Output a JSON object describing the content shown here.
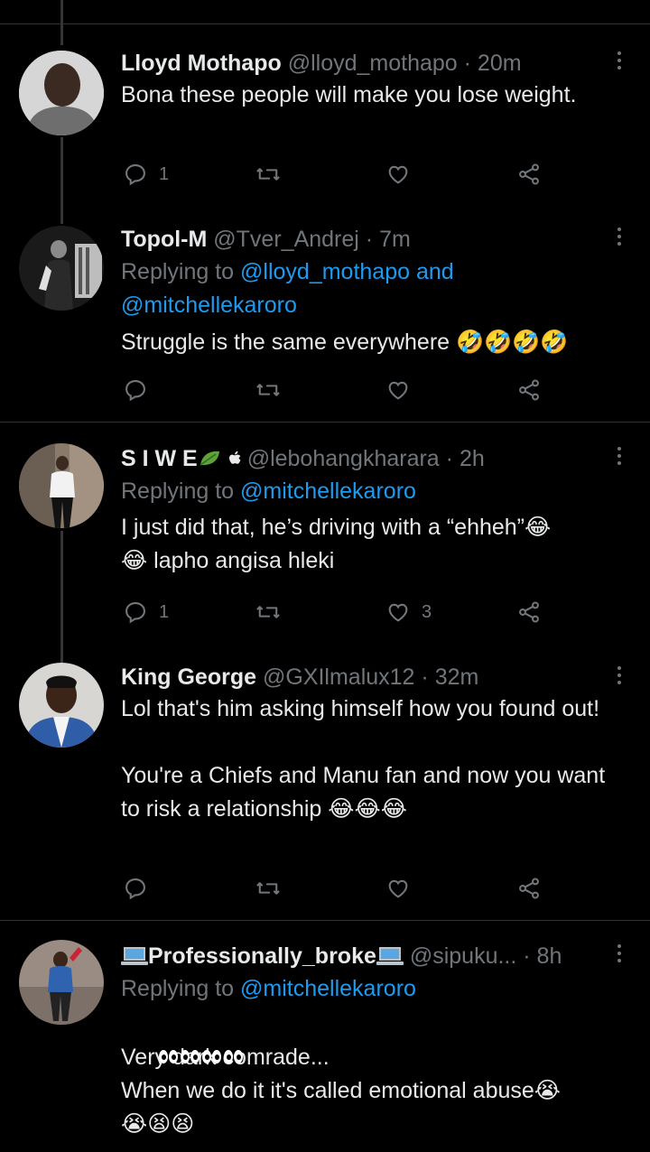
{
  "tweets": [
    {
      "name": "Lloyd Mothapo",
      "handle": "@lloyd_mothapo",
      "time": "· 20m",
      "replying_prefix": "",
      "replying_mentions": "",
      "text": "Bona these people will make you lose weight.",
      "emojis": "",
      "reply_count": "1",
      "like_count": ""
    },
    {
      "name": "Topol-M",
      "handle": "@Tver_Andrej",
      "time": "· 7m",
      "replying_prefix": "Replying to",
      "replying_mentions": "@lloyd_mothapo and @mitchellekaroro",
      "text": "Struggle is the same everywhere ",
      "emojis": "🤣🤣🤣🤣",
      "reply_count": "",
      "like_count": ""
    },
    {
      "name": "S I W E",
      "handle": "@lebohangkharara",
      "time": "· 2h",
      "replying_prefix": "Replying to",
      "replying_mentions": "@mitchellekaroro",
      "text": "I just did that, he’s driving with a “ehheh”😂\n😂 lapho angisa hleki",
      "emojis": "",
      "reply_count": "1",
      "like_count": "3"
    },
    {
      "name": "King George",
      "handle": "@GXIlmalux12",
      "time": "· 32m",
      "replying_prefix": "",
      "replying_mentions": "",
      "text": "Lol that's him asking himself how you found out!\n\nYou're a Chiefs and Manu fan and now you want to risk a relationship 😂😂😂",
      "emojis": "",
      "reply_count": "",
      "like_count": ""
    },
    {
      "name": "Professionally_broke",
      "handle": "@sipuku...",
      "time": "· 8h",
      "replying_prefix": "Replying to",
      "replying_mentions": "@mitchellekaroro",
      "text": "Very dark comrade...\nWhen we do it it's called emotional abuse😭\n😭😫😫",
      "emojis": "",
      "reply_count": "",
      "like_count": ""
    }
  ],
  "icons": {
    "reply": "reply-icon",
    "retweet": "retweet-icon",
    "like": "heart-icon",
    "share": "share-icon",
    "more": "more-options-icon"
  },
  "colors": {
    "background": "#000000",
    "text": "#e7e9ea",
    "muted": "#71767b",
    "link": "#1d9bf0",
    "divider": "#2f3336"
  }
}
